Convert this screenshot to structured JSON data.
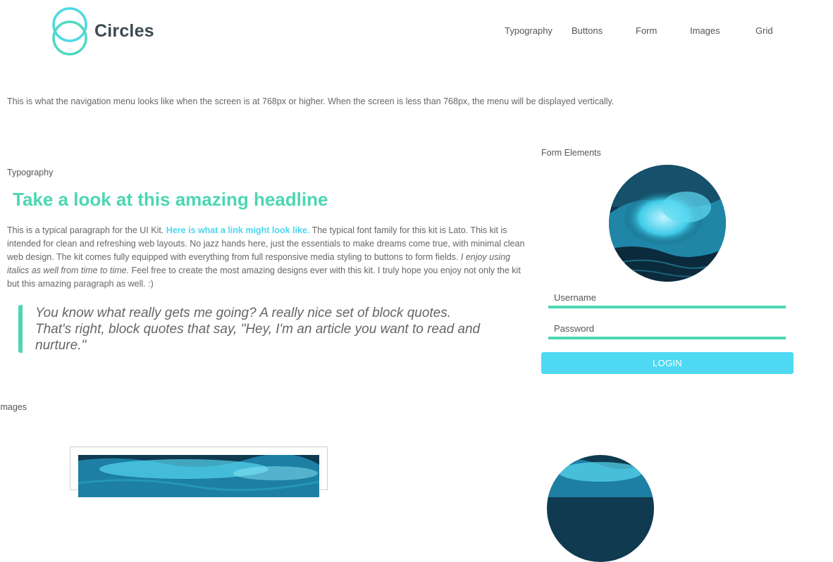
{
  "brand": {
    "name": "Circles"
  },
  "nav": {
    "items": [
      "Typography",
      "Buttons",
      "Form",
      "Images",
      "Grid"
    ]
  },
  "nav_note": "This is what the navigation menu looks like when the screen is at 768px or higher. When the screen is less than 768px, the menu will be displayed vertically.",
  "typography": {
    "label": "Typography",
    "headline": "Take a look at this amazing headline",
    "para_1": "This is a typical paragraph for the UI Kit. ",
    "link": "Here is what a link might look like.",
    "para_2": " The typical font family for this kit is Lato. This kit is intended for clean and refreshing web layouts. No jazz hands here, just the essentials to make dreams come true, with minimal clean web design. The kit comes fully equipped with everything from full responsive media styling to buttons to form fields. ",
    "italic": "I enjoy using italics as well from time to time.",
    "para_3": " Feel free to create the most amazing designs ever with this kit. I truly hope you enjoy not only the kit but this amazing paragraph as well. :)",
    "quote": "You know what really gets me going? A really nice set of block quotes. That's right, block quotes that say, \"Hey, I'm an article you want to read and nurture.\""
  },
  "form": {
    "label": "Form Elements",
    "username_placeholder": "Username",
    "password_placeholder": "Password",
    "login_label": "LOGIN"
  },
  "images": {
    "label": "Images"
  },
  "colors": {
    "accent_green": "#4dd6b3",
    "accent_cyan": "#4fd9f3",
    "text": "#666666"
  },
  "icons": {
    "logo": "circles-logo-icon"
  }
}
